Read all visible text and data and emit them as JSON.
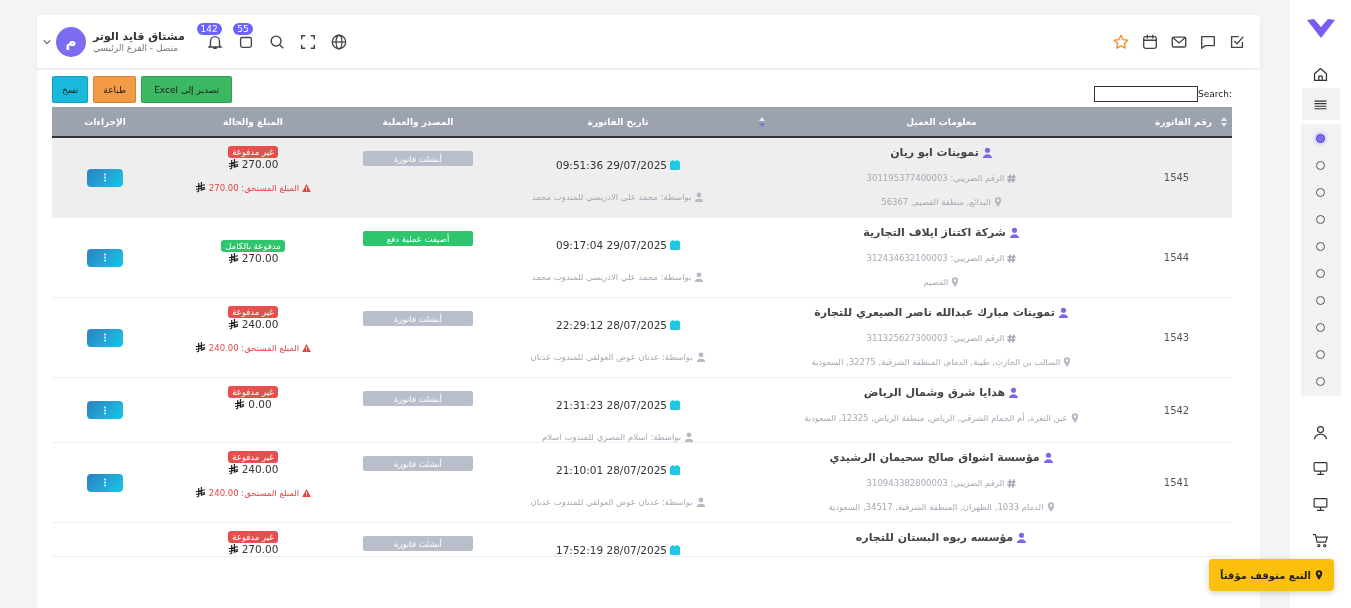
{
  "header": {
    "user": {
      "initial": "م",
      "name": "مشتاق قايد الوتر",
      "status": "متصل - الفرع الرئيسي"
    },
    "notifications": "142",
    "messages": "55"
  },
  "toolbar": {
    "buttons": [
      {
        "label": "تصدير إلى Excel",
        "kind": "excel"
      },
      {
        "label": "طباعة",
        "kind": "print"
      },
      {
        "label": "نسخ",
        "kind": "copy"
      }
    ],
    "search_label": "Search:"
  },
  "table": {
    "columns": [
      "رقم الفاتورة",
      "معلومات العميل",
      "تاريخ الفاتورة",
      "المصدر والعملية",
      "المبلغ والحالة",
      "الإجراءات"
    ],
    "rows": [
      {
        "selected": true,
        "number": "1545",
        "name": "تموينات ابو ريان",
        "tax": "الرقم الضريبي: 301195377400003",
        "address": "البدائع, منطقة القصيم, 56367",
        "date": "29/07/2025 09:51:36",
        "by": "بواسطة: محمد علي الادريسي للمندوب محمد",
        "source": {
          "kind": "invoice",
          "label": "أنشئت فاتورة"
        },
        "status": {
          "kind": "unpaid",
          "label": "غير مدفوعة"
        },
        "amount": "270.00",
        "due": "المبلغ المستحق: 270.00",
        "menu": true
      },
      {
        "selected": false,
        "number": "1544",
        "name": "شركة اكتناز ايلاف التجارية",
        "tax": "الرقم الضريبي: 312434632100003",
        "address": "القصيم",
        "date": "29/07/2025 09:17:04",
        "by": "بواسطة: محمد علي الادريسي للمندوب محمد",
        "source": {
          "kind": "payment",
          "label": "أضيفت عملية دفع"
        },
        "status": {
          "kind": "paid",
          "label": "مدفوعة بالكامل"
        },
        "amount": "270.00",
        "menu": true
      },
      {
        "selected": false,
        "number": "1543",
        "name": "تموينات مبارك عبدالله ناصر الصيعري للتجارة",
        "tax": "الرقم الضريبي: 311325627300003",
        "address": "السالب بن الحارث, طيبة, الدمام, المنطقة الشرقية, 32275, السعودية",
        "date": "28/07/2025 22:29:12",
        "by": "بواسطة: عدنان عوض العولقي للمندوب عدنان",
        "source": {
          "kind": "invoice",
          "label": "أنشئت فاتورة"
        },
        "status": {
          "kind": "unpaid",
          "label": "غير مدفوعة"
        },
        "amount": "240.00",
        "due": "المبلغ المستحق: 240.00",
        "menu": true
      },
      {
        "selected": false,
        "number": "1542",
        "name": "هدايا شرق وشمال الرياض",
        "address": "عين الثغرة, أم الحمام الشرقي, الرياض, منطقة الرياض, 12325, السعودية",
        "date": "28/07/2025 21:31:23",
        "by": "بواسطة: اسلام المصري للمندوب اسلام",
        "source": {
          "kind": "invoice",
          "label": "أنشئت فاتورة"
        },
        "status": {
          "kind": "unpaid",
          "label": "غير مدفوعة"
        },
        "amount": "0.00",
        "menu": true
      },
      {
        "selected": false,
        "number": "1541",
        "name": "مؤسسة اشواق صالح سحيمان الرشيدي",
        "tax": "الرقم الضريبي: 310943382800003",
        "address": "الدمام 1033, الظهران, المنطقة الشرقية, 34517, السعودية",
        "date": "28/07/2025 21:10:01",
        "by": "بواسطة: عدنان عوض العولقي للمندوب عدنان",
        "source": {
          "kind": "invoice",
          "label": "أنشئت فاتورة"
        },
        "status": {
          "kind": "unpaid",
          "label": "غير مدفوعة"
        },
        "amount": "240.00",
        "due": "المبلغ المستحق: 240.00",
        "menu": true
      },
      {
        "selected": false,
        "name": "مؤسسه ربوه البستان للتجاره",
        "date": "28/07/2025 17:52:19",
        "source": {
          "kind": "invoice",
          "label": "أنشئت فاتورة"
        },
        "status": {
          "kind": "unpaid",
          "label": "غير مدفوعة"
        },
        "amount": "270.00"
      }
    ]
  },
  "sidebar": {
    "items": [
      {
        "selected": true
      },
      {
        "selected": false
      },
      {
        "selected": false
      },
      {
        "selected": false
      },
      {
        "selected": false
      },
      {
        "selected": false
      },
      {
        "selected": false
      },
      {
        "selected": false
      },
      {
        "selected": false
      },
      {
        "selected": false
      }
    ]
  },
  "tracking_badge": "التبع متوقف مؤقتاً"
}
